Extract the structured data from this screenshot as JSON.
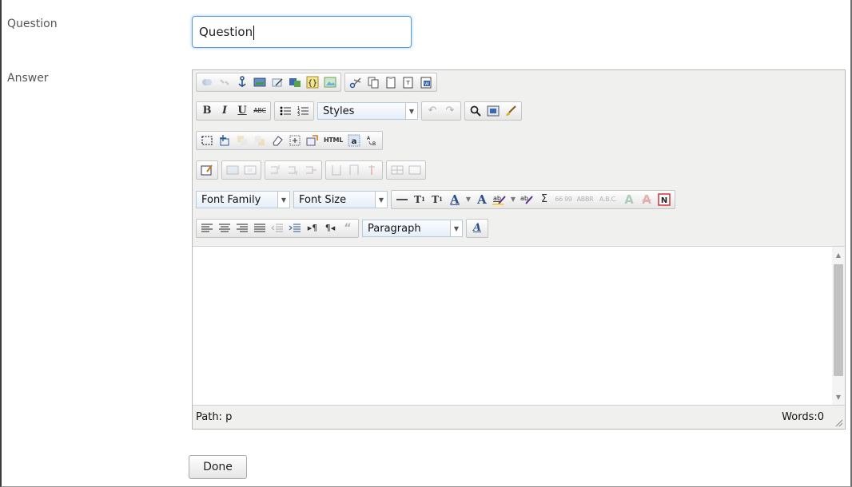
{
  "question": {
    "label": "Question",
    "value": "Question"
  },
  "answer": {
    "label": "Answer"
  },
  "toolbar": {
    "styles": "Styles",
    "font_family": "Font Family",
    "font_size": "Font Size",
    "paragraph": "Paragraph",
    "html_text": "HTML",
    "strike_text": "ABC",
    "abbr_text": "ABBR",
    "acronym_text": "A.B.C.",
    "quote_text": "66 99"
  },
  "status": {
    "path": "Path: p",
    "words": "Words:0"
  },
  "buttons": {
    "done": "Done"
  }
}
